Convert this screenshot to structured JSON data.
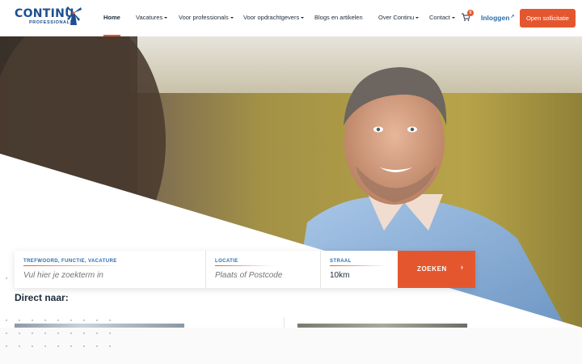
{
  "brand": {
    "name": "CONTINU",
    "sub": "PROFESSIONALS"
  },
  "nav": {
    "home": "Home",
    "vacatures": "Vacatures",
    "professionals": "Voor professionals",
    "opdrachtgevers": "Voor opdrachtgevers",
    "blogs": "Blogs en artikelen",
    "over": "Over Continu",
    "contact": "Contact",
    "cart_count": "0",
    "login": "Inloggen",
    "cta": "Open sollicitatie"
  },
  "search": {
    "keyword_label": "TREFWOORD, FUNCTIE, VACATURE",
    "keyword_placeholder": "Vul hier je zoekterm in",
    "location_label": "LOCATIE",
    "location_placeholder": "Plaats of Postcode",
    "radius_label": "STRAAL",
    "radius_value": "10km",
    "button": "ZOEKEN"
  },
  "section": {
    "direct_title": "Direct naar:"
  },
  "colors": {
    "accent": "#e4572e",
    "brand_blue": "#1d4f91",
    "link_blue": "#2a6db0"
  },
  "icons": [
    "windmill-logo-icon",
    "chevron-down-icon",
    "cart-icon",
    "external-link-icon",
    "chevron-right-icon"
  ]
}
